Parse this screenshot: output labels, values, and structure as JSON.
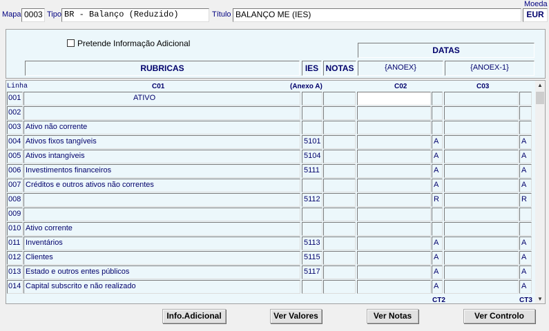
{
  "header": {
    "mapa_label": "Mapa",
    "mapa_value": "0003",
    "tipo_label": "Tipo",
    "tipo_value": "BR - Balanço (Reduzido)",
    "titulo_label": "Título",
    "titulo_value": "BALANÇO ME (IES)",
    "moeda_label": "Moeda",
    "moeda_value": "EUR"
  },
  "options": {
    "info_adicional_label": "Pretende Informação Adicional"
  },
  "column_headers": {
    "datas": "DATAS",
    "rubricas": "RUBRICAS",
    "ies": "IES",
    "notas": "NOTAS",
    "anoex": "{ANOEX}",
    "anoex1": "{ANOEX-1}",
    "linha": "Linha",
    "c01": "C01",
    "anexo": "(Anexo A)",
    "c02": "C02",
    "c03": "C03",
    "ct2": "CT2",
    "ct3": "CT3"
  },
  "rows": [
    {
      "linha": "001",
      "rubrica": "ATIVO",
      "ies": "",
      "ct2": "",
      "ct3": ""
    },
    {
      "linha": "002",
      "rubrica": "",
      "ies": "",
      "ct2": "",
      "ct3": ""
    },
    {
      "linha": "003",
      "rubrica": "Ativo não corrente",
      "ies": "",
      "ct2": "",
      "ct3": ""
    },
    {
      "linha": "004",
      "rubrica": "Ativos fixos tangíveis",
      "ies": "5101",
      "ct2": "A",
      "ct3": "A"
    },
    {
      "linha": "005",
      "rubrica": "Ativos intangíveis",
      "ies": "5104",
      "ct2": "A",
      "ct3": "A"
    },
    {
      "linha": "006",
      "rubrica": "Investimentos financeiros",
      "ies": "5111",
      "ct2": "A",
      "ct3": "A"
    },
    {
      "linha": "007",
      "rubrica": "Créditos e outros ativos não correntes",
      "ies": "",
      "ct2": "A",
      "ct3": "A"
    },
    {
      "linha": "008",
      "rubrica": "",
      "ies": "5112",
      "ct2": "R",
      "ct3": "R"
    },
    {
      "linha": "009",
      "rubrica": "",
      "ies": "",
      "ct2": "",
      "ct3": ""
    },
    {
      "linha": "010",
      "rubrica": "Ativo corrente",
      "ies": "",
      "ct2": "",
      "ct3": ""
    },
    {
      "linha": "011",
      "rubrica": "Inventários",
      "ies": "5113",
      "ct2": "A",
      "ct3": "A"
    },
    {
      "linha": "012",
      "rubrica": "Clientes",
      "ies": "5115",
      "ct2": "A",
      "ct3": "A"
    },
    {
      "linha": "013",
      "rubrica": "Estado e outros entes públicos",
      "ies": "5117",
      "ct2": "A",
      "ct3": "A"
    },
    {
      "linha": "014",
      "rubrica": "Capital subscrito e não realizado",
      "ies": "",
      "ct2": "A",
      "ct3": "A"
    }
  ],
  "buttons": {
    "info_adicional": "Info.Adicional",
    "ver_valores": "Ver Valores",
    "ver_notas": "Ver Notas",
    "ver_controlo": "Ver Controlo"
  },
  "icons": {
    "scroll_up": "scroll-up-arrow-icon",
    "scroll_down": "scroll-down-arrow-icon"
  }
}
